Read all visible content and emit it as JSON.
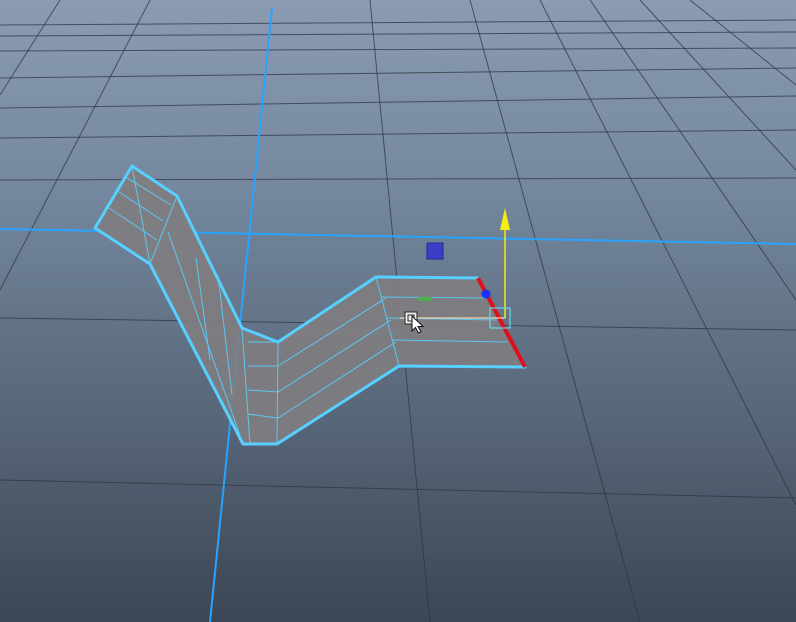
{
  "viewport": {
    "view": "perspective",
    "background_colors": [
      "#8a9bb2",
      "#75889f",
      "#5d6d80",
      "#3c4654"
    ]
  },
  "grid": {
    "line_color": "#2f3640",
    "axis_color": "#29a3ff"
  },
  "mesh": {
    "name": "polygon mesh",
    "selected": true,
    "wire_color": "#58d0ff",
    "face_color": "#7f7d80"
  },
  "manipulator": {
    "tool": "move",
    "x_axis_color": "#e0101a",
    "y_axis_color": "#f2ee10",
    "z_axis_color": "#1a30ff",
    "center_color": "#68d8f0",
    "handle_colors": [
      "#3a3fc8",
      "#4caf50"
    ],
    "icons": [
      "pivot-icon",
      "cursor-arrow-icon"
    ]
  }
}
